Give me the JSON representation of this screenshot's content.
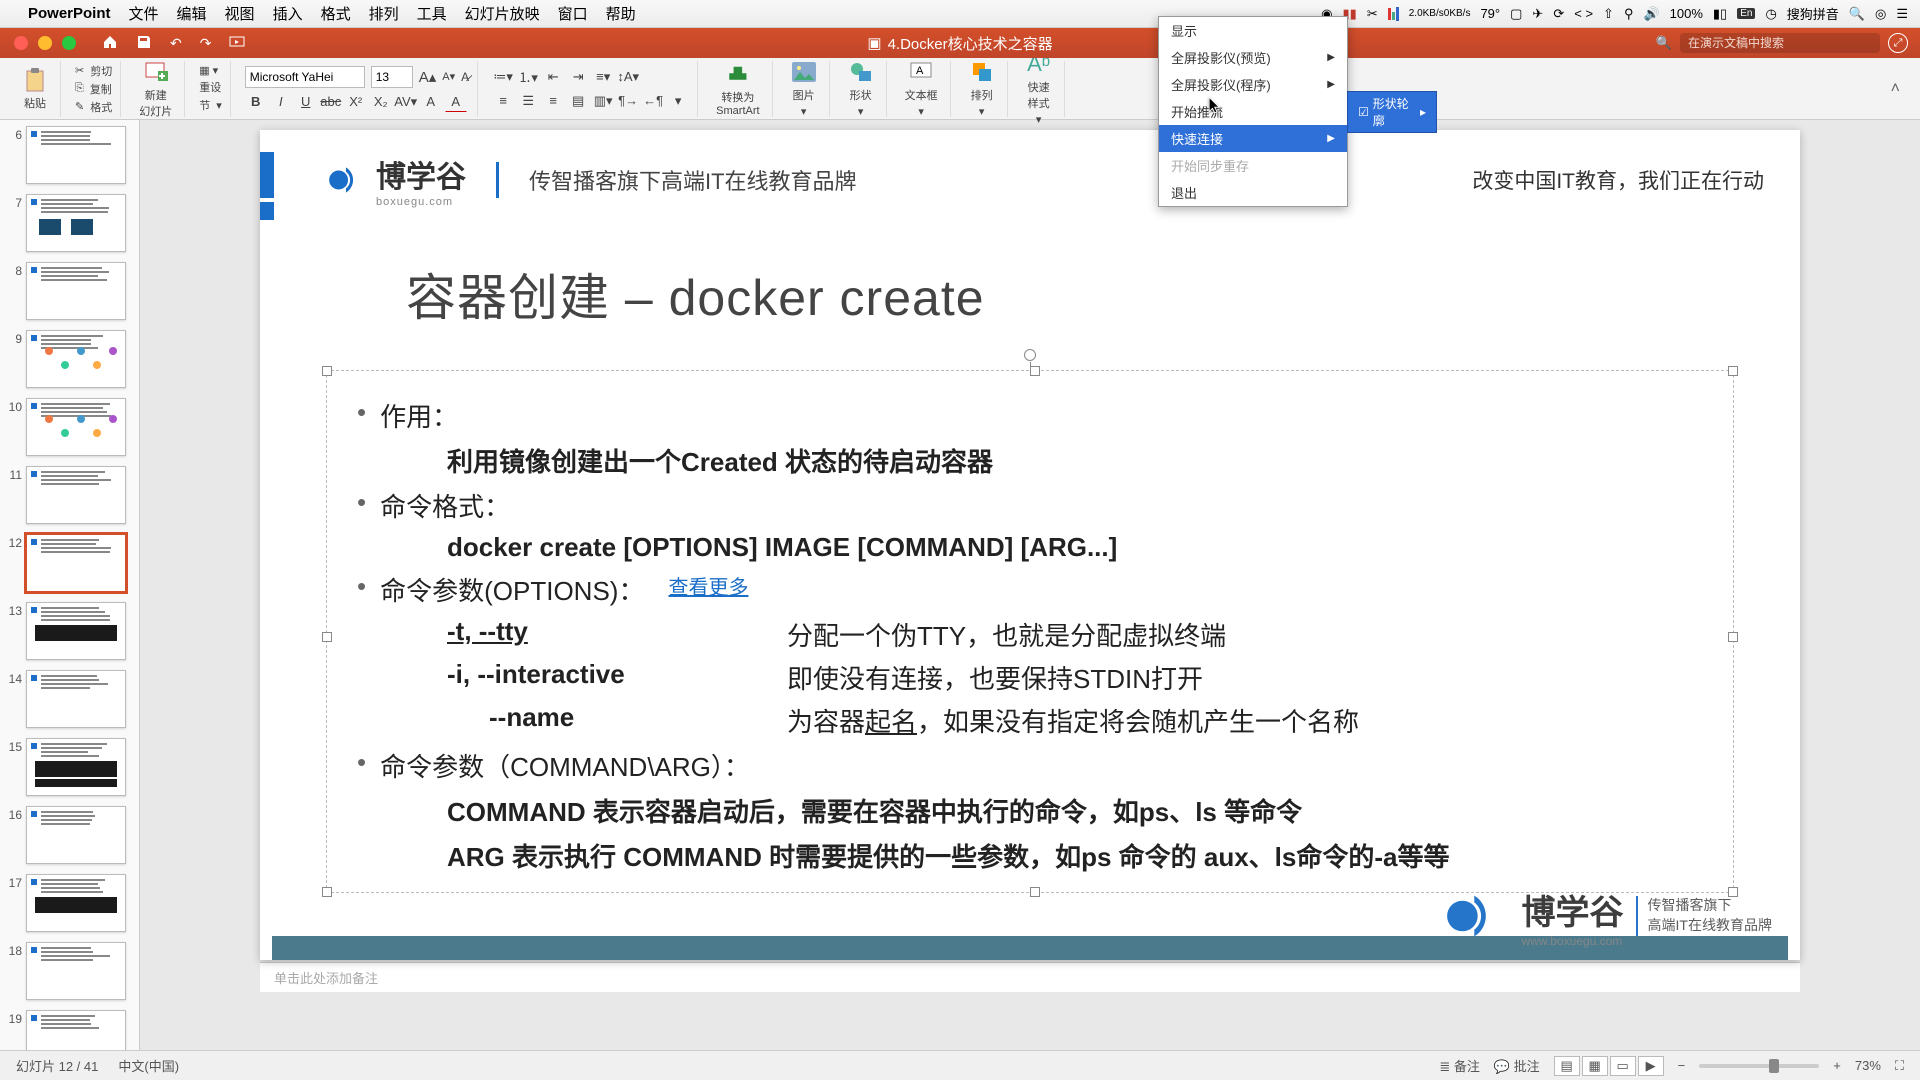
{
  "macMenu": {
    "app": "PowerPoint",
    "items": [
      "文件",
      "编辑",
      "视图",
      "插入",
      "格式",
      "排列",
      "工具",
      "幻灯片放映",
      "窗口",
      "帮助"
    ],
    "status": {
      "net": "2.0KB/s",
      "net2": "0KB/s",
      "temp": "79°",
      "battery": "100%",
      "ime": "搜狗拼音"
    }
  },
  "titlebar": {
    "docTitle": "4.Docker核心技术之容器",
    "searchPlaceholder": "在演示文稿中搜索"
  },
  "ribbon": {
    "paste": "粘贴",
    "cut": "剪切",
    "copy": "复制",
    "format": "格式",
    "newSlide": "新建\n幻灯片",
    "reset": "重设",
    "section": "节",
    "fontName": "Microsoft YaHei",
    "fontSize": "13",
    "smartart": "转换为\nSmartArt",
    "picture": "图片",
    "shapes": "形状",
    "textbox": "文本框",
    "arrange": "排列",
    "quickstyle": "快速\n样式"
  },
  "contextMenu": {
    "items": [
      {
        "label": "显示",
        "arrow": false,
        "disabled": false
      },
      {
        "label": "全屏投影仪(预览)",
        "arrow": true,
        "disabled": false
      },
      {
        "label": "全屏投影仪(程序)",
        "arrow": true,
        "disabled": false
      },
      {
        "label": "开始推流",
        "arrow": false,
        "disabled": false
      },
      {
        "label": "快速连接",
        "arrow": true,
        "disabled": false,
        "highlight": true
      },
      {
        "label": "开始同步重存",
        "arrow": false,
        "disabled": true
      },
      {
        "label": "退出",
        "arrow": false,
        "disabled": false
      }
    ],
    "submenu": {
      "icon": "☑",
      "label": "形状轮廓",
      "arrow": "▸"
    }
  },
  "thumbs": {
    "start": 6,
    "count": 14,
    "selected": 12
  },
  "slide": {
    "logoName": "博学谷",
    "logoSub": "boxuegu.com",
    "brandTag": "传智播客旗下高端IT在线教育品牌",
    "headerRight": "改变中国IT教育，我们正在行动",
    "title": "容器创建 – docker create",
    "b1": "作用：",
    "b1text": "利用镜像创建出一个Created 状态的待启动容器",
    "b2": "命令格式：",
    "b2text": "docker create [OPTIONS] IMAGE [COMMAND] [ARG...]",
    "b3": "命令参数(OPTIONS)：",
    "linkMore": "查看更多",
    "opt1l": "-t, --tty",
    "opt1r": "分配一个伪TTY，也就是分配虚拟终端",
    "opt2l": "-i, --interactive",
    "opt2r": "即使没有连接，也要保持STDIN打开",
    "opt3l": "--name",
    "opt3r1": "为容器",
    "opt3r2": "起名",
    "opt3r3": "，如果没有指定将会随机产生一个名称",
    "b4": "命令参数（COMMAND\\ARG）：",
    "b4t1": "COMMAND 表示容器启动后，需要在容器中执行的命令，如ps、ls 等命令",
    "b4t2": "ARG 表示执行 COMMAND 时需要提供的一些参数，如ps 命令的 aux、ls命令的-a等等",
    "wmText": "博学谷",
    "wmSub1": "传智播客旗下",
    "wmSub2": "高端IT在线教育品牌",
    "wmUrl": "www.boxuegu.com"
  },
  "notes": "单击此处添加备注",
  "status": {
    "slide": "幻灯片 12 / 41",
    "lang": "中文(中国)",
    "notes": "备注",
    "comments": "批注",
    "zoom": "73%"
  }
}
